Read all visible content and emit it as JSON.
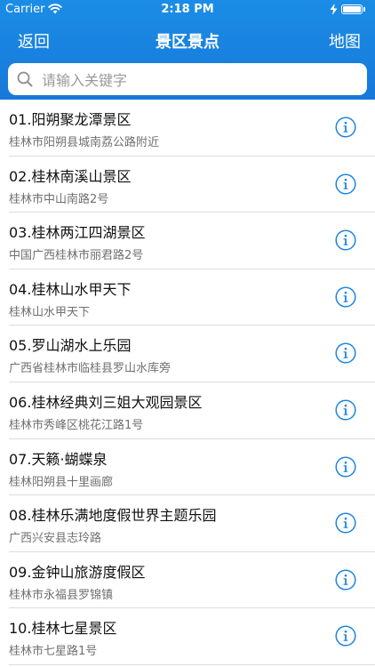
{
  "status_bar": {
    "carrier": "Carrier",
    "time": "2:18 PM",
    "wifi_icon": "wifi-icon",
    "battery_icon": "battery-icon"
  },
  "nav": {
    "back_label": "返回",
    "title": "景区景点",
    "map_label": "地图"
  },
  "search": {
    "placeholder": "请输入关键字",
    "value": ""
  },
  "items": [
    {
      "title": "01.阳朔聚龙潭景区",
      "address": "桂林市阳朔县城南荔公路附近"
    },
    {
      "title": "02.桂林南溪山景区",
      "address": "桂林市中山南路2号"
    },
    {
      "title": "03.桂林两江四湖景区",
      "address": "中国广西桂林市丽君路2号"
    },
    {
      "title": "04.桂林山水甲天下",
      "address": "桂林山水甲天下"
    },
    {
      "title": "05.罗山湖水上乐园",
      "address": "广西省桂林市临桂县罗山水库旁"
    },
    {
      "title": "06.桂林经典刘三姐大观园景区",
      "address": "桂林市秀峰区桃花江路1号"
    },
    {
      "title": "07.天籁·蝴蝶泉",
      "address": "桂林阳朔县十里画廊"
    },
    {
      "title": "08.桂林乐满地度假世界主题乐园",
      "address": "广西兴安县志玲路"
    },
    {
      "title": "09.金钟山旅游度假区",
      "address": "桂林市永福县罗锦镇"
    },
    {
      "title": "10.桂林七星景区",
      "address": "桂林市七星路1号"
    }
  ],
  "colors": {
    "accent": "#1a84e0",
    "header_bg": "#1b8de6"
  }
}
